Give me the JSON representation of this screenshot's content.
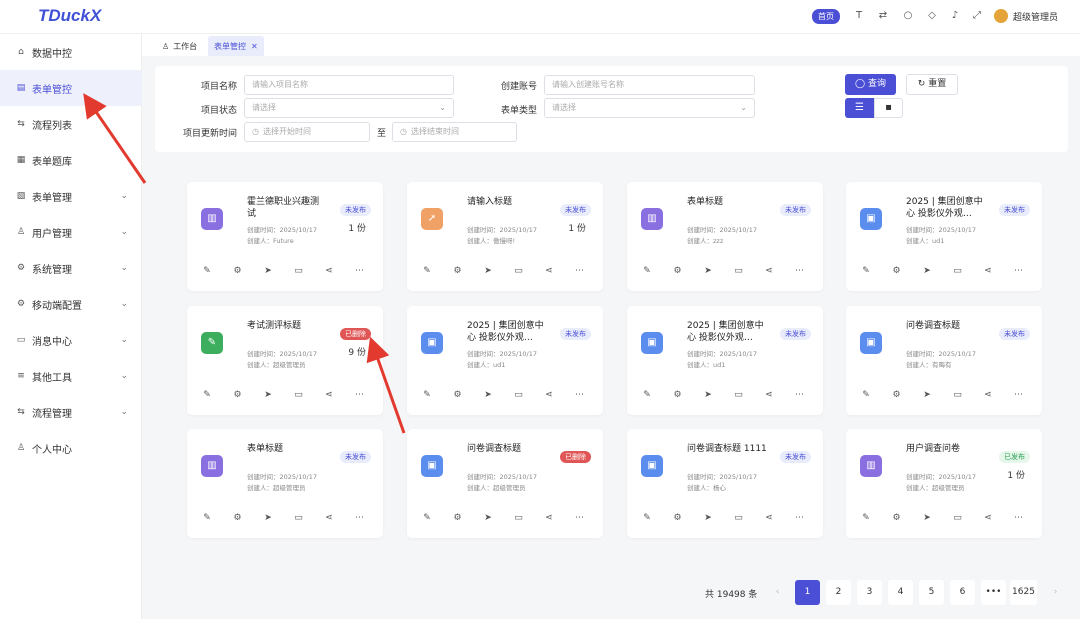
{
  "app": {
    "logo": "TDuckX",
    "home_label": "首页",
    "username": "超级管理员"
  },
  "sidebar": {
    "items": [
      {
        "label": "数据中控",
        "icon": "home-icon",
        "chev": false
      },
      {
        "label": "表单管控",
        "icon": "form-icon",
        "chev": false,
        "active": true
      },
      {
        "label": "流程列表",
        "icon": "flow-icon",
        "chev": false
      },
      {
        "label": "表单题库",
        "icon": "grid-icon",
        "chev": false
      },
      {
        "label": "表单管理",
        "icon": "form-manage-icon",
        "chev": true
      },
      {
        "label": "用户管理",
        "icon": "user-icon",
        "chev": true
      },
      {
        "label": "系统管理",
        "icon": "gear-icon",
        "chev": true
      },
      {
        "label": "移动端配置",
        "icon": "gear-icon",
        "chev": true
      },
      {
        "label": "消息中心",
        "icon": "message-icon",
        "chev": true
      },
      {
        "label": "其他工具",
        "icon": "menu-icon",
        "chev": true
      },
      {
        "label": "流程管理",
        "icon": "flow-icon",
        "chev": true
      },
      {
        "label": "个人中心",
        "icon": "user-icon",
        "chev": false
      }
    ]
  },
  "tabs": [
    {
      "label": "工作台"
    },
    {
      "label": "表单管控",
      "active": true
    }
  ],
  "filter": {
    "project_name_label": "项目名称",
    "project_name_placeholder": "请输入项目名称",
    "creator_label": "创建账号",
    "creator_placeholder": "请输入创建账号名称",
    "status_label": "项目状态",
    "status_placeholder": "请选择",
    "type_label": "表单类型",
    "type_placeholder": "请选择",
    "updated_label": "项目更新时间",
    "start_placeholder": "选择开始时间",
    "to_label": "至",
    "end_placeholder": "选择结束时间",
    "query_label": "查询",
    "reset_label": "重置"
  },
  "cards": [
    {
      "title": "霍兰德职业兴趣测试",
      "created": "创建时间：2025/10/17",
      "creator": "创建人：Future",
      "badge": "未发布",
      "badge_type": "unpub",
      "count": "1 份",
      "icon_color": "#8a6fe0",
      "icon": "chart-icon"
    },
    {
      "title": "请输入标题",
      "created": "创建时间：2025/10/17",
      "creator": "创建人：傲慢呀!",
      "badge": "未发布",
      "badge_type": "unpub",
      "count": "1 份",
      "icon_color": "#f0a266",
      "icon": "rocket-icon"
    },
    {
      "title": "表单标题",
      "created": "创建时间：2025/10/17",
      "creator": "创建人：zzz",
      "badge": "未发布",
      "badge_type": "unpub",
      "count": "",
      "icon_color": "#8a6fe0",
      "icon": "chart-icon"
    },
    {
      "title": "2025 | 集团创意中心 投影仪外观…",
      "created": "创建时间：2025/10/17",
      "creator": "创建人：ud1",
      "badge": "未发布",
      "badge_type": "unpub",
      "count": "",
      "icon_color": "#5b8def",
      "icon": "doc-icon"
    },
    {
      "title": "考试测评标题",
      "created": "创建时间：2025/10/17",
      "creator": "创建人：超级管理员",
      "badge": "已删除",
      "badge_type": "deleted",
      "count": "9 份",
      "icon_color": "#3dae5e",
      "icon": "exam-icon"
    },
    {
      "title": "2025 | 集团创意中心 投影仪外观…",
      "created": "创建时间：2025/10/17",
      "creator": "创建人：ud1",
      "badge": "未发布",
      "badge_type": "unpub",
      "count": "",
      "icon_color": "#5b8def",
      "icon": "doc-icon"
    },
    {
      "title": "2025 | 集团创意中心 投影仪外观…",
      "created": "创建时间：2025/10/17",
      "creator": "创建人：ud1",
      "badge": "未发布",
      "badge_type": "unpub",
      "count": "",
      "icon_color": "#5b8def",
      "icon": "doc-icon"
    },
    {
      "title": "问卷调查标题",
      "created": "创建时间：2025/10/17",
      "creator": "创建人：有晦有",
      "badge": "未发布",
      "badge_type": "unpub",
      "count": "",
      "icon_color": "#5b8def",
      "icon": "doc-icon"
    },
    {
      "title": "表单标题",
      "created": "创建时间：2025/10/17",
      "creator": "创建人：超级管理员",
      "badge": "未发布",
      "badge_type": "unpub",
      "count": "",
      "icon_color": "#8a6fe0",
      "icon": "chart-icon"
    },
    {
      "title": "问卷调查标题",
      "created": "创建时间：2025/10/17",
      "creator": "创建人：超级管理员",
      "badge": "已删除",
      "badge_type": "deleted",
      "count": "",
      "icon_color": "#5b8def",
      "icon": "doc-icon"
    },
    {
      "title": "问卷调查标题 1111",
      "created": "创建时间：2025/10/17",
      "creator": "创建人：杨心",
      "badge": "未发布",
      "badge_type": "unpub",
      "count": "",
      "icon_color": "#5b8def",
      "icon": "doc-icon"
    },
    {
      "title": "用户调查问卷",
      "created": "创建时间：2025/10/17",
      "creator": "创建人：超级管理员",
      "badge": "已发布",
      "badge_type": "pub",
      "count": "1 份",
      "icon_color": "#8a6fe0",
      "icon": "chart-icon"
    }
  ],
  "pagination": {
    "total": "共 19498 条",
    "pages": [
      "1",
      "2",
      "3",
      "4",
      "5",
      "6",
      "•••",
      "1625"
    ]
  }
}
